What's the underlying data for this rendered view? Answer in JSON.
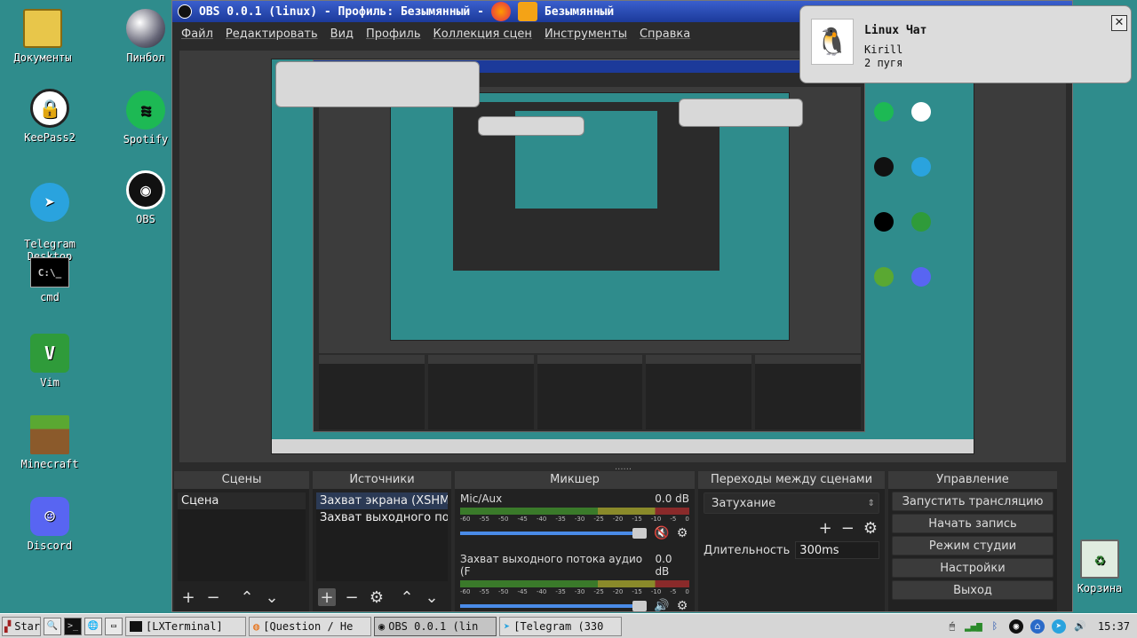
{
  "desktop": {
    "icons": [
      {
        "label": "Документы",
        "glyph": "▤",
        "icon": "folder-icon"
      },
      {
        "label": "Пинбол",
        "glyph": "",
        "icon": "pinball-icon"
      },
      {
        "label": "KeePass2",
        "glyph": "🔒",
        "icon": "lock-icon"
      },
      {
        "label": "Spotify",
        "glyph": "≋",
        "icon": "spotify-icon"
      },
      {
        "label": "Telegram\nDesktop",
        "glyph": "➤",
        "icon": "telegram-icon"
      },
      {
        "label": "OBS",
        "glyph": "◉",
        "icon": "obs-icon"
      },
      {
        "label": "cmd",
        "glyph": "C:\\_",
        "icon": "terminal-icon"
      },
      {
        "label": "Vim",
        "glyph": "V",
        "icon": "vim-icon"
      },
      {
        "label": "Minecraft",
        "glyph": "",
        "icon": "minecraft-icon"
      },
      {
        "label": "Discord",
        "glyph": "☺",
        "icon": "discord-icon"
      },
      {
        "label": "Корзина",
        "glyph": "♻",
        "icon": "trash-icon"
      }
    ]
  },
  "obs": {
    "title": "OBS 0.0.1 (linux) - Профиль: Безымянный -",
    "title_suffix": "Безымянный",
    "menu": [
      "Файл",
      "Редактировать",
      "Вид",
      "Профиль",
      "Коллекция сцен",
      "Инструменты",
      "Справка"
    ],
    "splitter": "......",
    "scenes": {
      "header": "Сцены",
      "items": [
        "Сцена"
      ]
    },
    "sources": {
      "header": "Источники",
      "items": [
        "Захват экрана (XSHM)",
        "Захват выходного пот"
      ]
    },
    "mixer": {
      "header": "Микшер",
      "channels": [
        {
          "name": "Mic/Aux",
          "db": "0.0 dB",
          "muted": true
        },
        {
          "name": "Захват выходного потока аудио (F",
          "db": "0.0 dB",
          "muted": false
        }
      ],
      "scale": [
        "-60",
        "-55",
        "-50",
        "-45",
        "-40",
        "-35",
        "-30",
        "-25",
        "-20",
        "-15",
        "-10",
        "-5",
        "0"
      ]
    },
    "transitions": {
      "header": "Переходы между сценами",
      "selected": "Затухание",
      "duration_label": "Длительность",
      "duration_value": "300ms"
    },
    "controls": {
      "header": "Управление",
      "buttons": [
        "Запустить трансляцию",
        "Начать запись",
        "Режим студии",
        "Настройки",
        "Выход"
      ]
    }
  },
  "notification": {
    "title": "Linux Чат",
    "line1": "Kirill",
    "line2": "2 пугя"
  },
  "taskbar": {
    "start": "Start",
    "windows": [
      "[LXTerminal]",
      "[Question / He",
      "OBS 0.0.1 (lin",
      "[Telegram (330"
    ],
    "clock": "15:37"
  },
  "colors": {
    "desktop": "#2f8c8c",
    "titlebar": "#1c3a9a",
    "obs_bg": "#2b2b2b"
  }
}
